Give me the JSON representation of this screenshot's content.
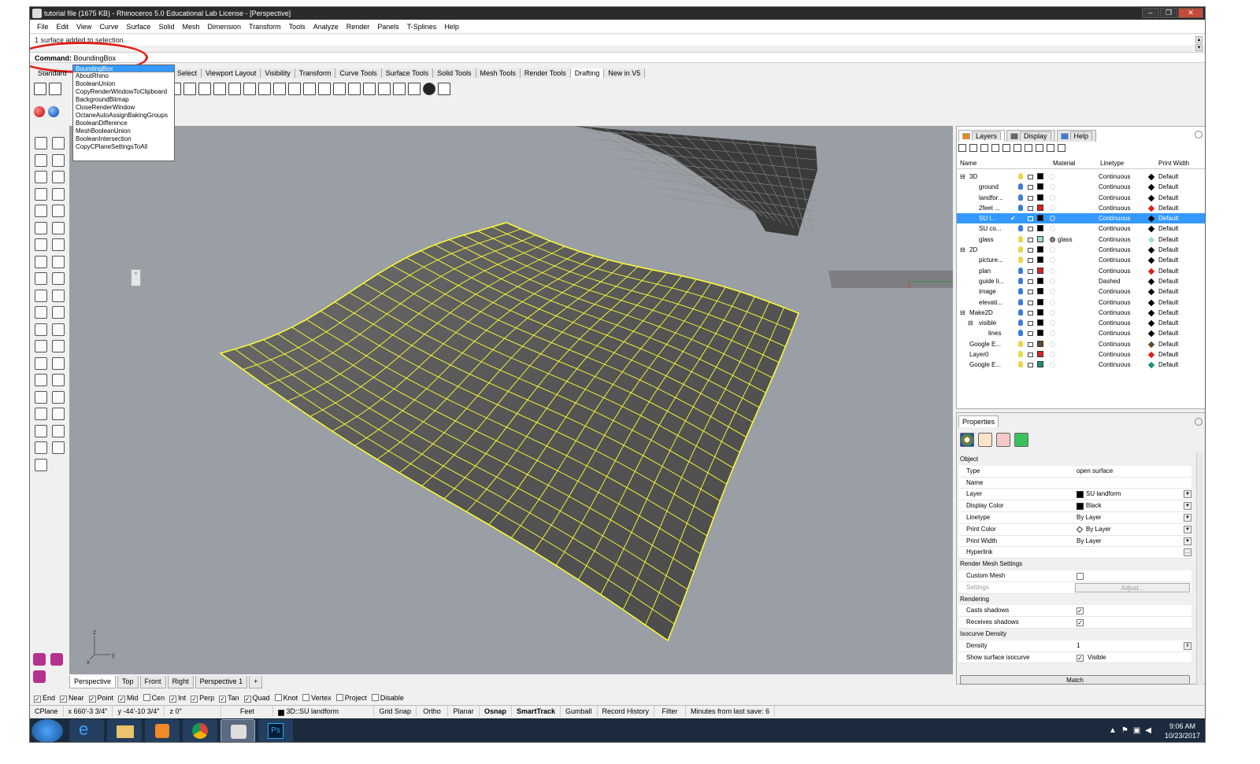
{
  "window": {
    "title": "tutorial file (1675 KB) - Rhinoceros 5.0 Educational Lab License - [Perspective]",
    "buttons": [
      "–",
      "❐",
      "✕"
    ]
  },
  "menu": [
    "File",
    "Edit",
    "View",
    "Curve",
    "Surface",
    "Solid",
    "Mesh",
    "Dimension",
    "Transform",
    "Tools",
    "Analyze",
    "Render",
    "Panels",
    "T-Splines",
    "Help"
  ],
  "command": {
    "history_line": "1 surface added to selection.",
    "prompt_label": "Command:",
    "current_input": "BoundingBox"
  },
  "autocomplete": {
    "items": [
      "BoundingBox",
      "AboutRhino",
      "BooleanUnion",
      "CopyRenderWindowToClipboard",
      "BackgroundBitmap",
      "CloseRenderWindow",
      "OctaneAutoAssignBakingGroups",
      "BooleanDifference",
      "MeshBooleanUnion",
      "BooleanIntersection",
      "CopyCPlaneSettingsToAll"
    ]
  },
  "toolbar_tabs": {
    "standard": "Standard",
    "tabs": [
      "Select",
      "Viewport Layout",
      "Visibility",
      "Transform",
      "Curve Tools",
      "Surface Tools",
      "Solid Tools",
      "Mesh Tools",
      "Render Tools",
      "Drafting",
      "New in V5"
    ]
  },
  "viewport": {
    "axis_z": "z",
    "axis_x": "x",
    "axis_y": "y",
    "tabs": [
      "Perspective",
      "Top",
      "Front",
      "Right",
      "Perspective 1",
      "+"
    ]
  },
  "osnap": [
    {
      "label": "End",
      "checked": true
    },
    {
      "label": "Near",
      "checked": true
    },
    {
      "label": "Point",
      "checked": true
    },
    {
      "label": "Mid",
      "checked": true
    },
    {
      "label": "Cen",
      "checked": false
    },
    {
      "label": "Int",
      "checked": true
    },
    {
      "label": "Perp",
      "checked": true
    },
    {
      "label": "Tan",
      "checked": true
    },
    {
      "label": "Quad",
      "checked": true
    },
    {
      "label": "Knot",
      "checked": false
    },
    {
      "label": "Vertex",
      "checked": false
    },
    {
      "label": "Project",
      "checked": false
    },
    {
      "label": "Disable",
      "checked": false
    }
  ],
  "status": {
    "cplane": "CPlane",
    "x": "x 660'-3 3/4\"",
    "y": "y -44'-10 3/4\"",
    "z": "z 0\"",
    "units": "Feet",
    "layer": "3D::SU landform",
    "toggles": [
      "Grid Snap",
      "Ortho",
      "Planar",
      "Osnap",
      "SmartTrack",
      "Gumball",
      "Record History",
      "Filter"
    ],
    "bold_toggles": [
      "Osnap",
      "SmartTrack"
    ],
    "save_info": "Minutes from last save: 6"
  },
  "taskbar": {
    "time": "9:06 AM",
    "date": "10/23/2017"
  },
  "layers_panel": {
    "tabs": [
      "Layers",
      "Display",
      "Help"
    ],
    "columns": {
      "name": "Name",
      "material": "Material",
      "linetype": "Linetype",
      "print_width": "Print Width"
    },
    "rows": [
      {
        "expander": "⊟",
        "indent": 0,
        "name": "3D",
        "color": "#000000",
        "linetype": "Continuous",
        "pw": "Default",
        "pwcolor": "#000000",
        "bulb": "#e8d84a",
        "selected": false
      },
      {
        "expander": "",
        "indent": 1,
        "name": "ground",
        "color": "#000000",
        "linetype": "Continuous",
        "pw": "Default",
        "pwcolor": "#000000",
        "bulb": "#3c7bd6",
        "selected": false
      },
      {
        "expander": "",
        "indent": 1,
        "name": "landfor...",
        "color": "#000000",
        "linetype": "Continuous",
        "pw": "Default",
        "pwcolor": "#000000",
        "bulb": "#3c7bd6",
        "selected": false
      },
      {
        "expander": "",
        "indent": 1,
        "name": "2feet ...",
        "color": "#e0201a",
        "linetype": "Continuous",
        "pw": "Default",
        "pwcolor": "#e0201a",
        "bulb": "#3c7bd6",
        "selected": false
      },
      {
        "expander": "",
        "indent": 1,
        "name": "SU l...",
        "color": "#000000",
        "linetype": "Continuous",
        "pw": "Default",
        "pwcolor": "#000000",
        "bulb": "",
        "selected": true,
        "check": "✔"
      },
      {
        "expander": "",
        "indent": 1,
        "name": "SU co...",
        "color": "#000000",
        "linetype": "Continuous",
        "pw": "Default",
        "pwcolor": "#000000",
        "bulb": "#3c7bd6",
        "selected": false
      },
      {
        "expander": "",
        "indent": 1,
        "name": "glass",
        "color": "#9ee0c8",
        "linetype": "Continuous",
        "pw": "Default",
        "pwcolor": "#9ee0c8",
        "bulb": "#e8d84a",
        "selected": false,
        "material": "glass"
      },
      {
        "expander": "⊟",
        "indent": 0,
        "name": "2D",
        "color": "#000000",
        "linetype": "Continuous",
        "pw": "Default",
        "pwcolor": "#000000",
        "bulb": "#e8d84a",
        "selected": false
      },
      {
        "expander": "",
        "indent": 1,
        "name": "picture...",
        "color": "#000000",
        "linetype": "Continuous",
        "pw": "Default",
        "pwcolor": "#000000",
        "bulb": "#e8d84a",
        "selected": false
      },
      {
        "expander": "",
        "indent": 1,
        "name": "plan",
        "color": "#e0201a",
        "linetype": "Continuous",
        "pw": "Default",
        "pwcolor": "#e0201a",
        "bulb": "#3c7bd6",
        "selected": false
      },
      {
        "expander": "",
        "indent": 1,
        "name": "guide li...",
        "color": "#000000",
        "linetype": "Dashed",
        "pw": "Default",
        "pwcolor": "#000000",
        "bulb": "#3c7bd6",
        "selected": false
      },
      {
        "expander": "",
        "indent": 1,
        "name": "image",
        "color": "#000000",
        "linetype": "Continuous",
        "pw": "Default",
        "pwcolor": "#000000",
        "bulb": "#3c7bd6",
        "selected": false
      },
      {
        "expander": "",
        "indent": 1,
        "name": "elevati...",
        "color": "#000000",
        "linetype": "Continuous",
        "pw": "Default",
        "pwcolor": "#000000",
        "bulb": "#3c7bd6",
        "selected": false
      },
      {
        "expander": "⊟",
        "indent": 0,
        "name": "Make2D",
        "color": "#000000",
        "linetype": "Continuous",
        "pw": "Default",
        "pwcolor": "#000000",
        "bulb": "#3c7bd6",
        "selected": false
      },
      {
        "expander": "⊟",
        "indent": 1,
        "name": "visible",
        "color": "#000000",
        "linetype": "Continuous",
        "pw": "Default",
        "pwcolor": "#000000",
        "bulb": "#3c7bd6",
        "selected": false
      },
      {
        "expander": "",
        "indent": 2,
        "name": "lines",
        "color": "#000000",
        "linetype": "Continuous",
        "pw": "Default",
        "pwcolor": "#000000",
        "bulb": "#3c7bd6",
        "selected": false
      },
      {
        "expander": "",
        "indent": 0,
        "name": "Google E...",
        "color": "#6b4a2a",
        "linetype": "Continuous",
        "pw": "Default",
        "pwcolor": "#6b4a2a",
        "bulb": "#e8d84a",
        "selected": false
      },
      {
        "expander": "",
        "indent": 0,
        "name": "Layer0",
        "color": "#e0201a",
        "linetype": "Continuous",
        "pw": "Default",
        "pwcolor": "#e0201a",
        "bulb": "#e8d84a",
        "selected": false
      },
      {
        "expander": "",
        "indent": 0,
        "name": "Google E...",
        "color": "#1e8f7a",
        "linetype": "Continuous",
        "pw": "Default",
        "pwcolor": "#1e8f7a",
        "bulb": "#e8d84a",
        "selected": false
      }
    ]
  },
  "properties_panel": {
    "tab": "Properties",
    "rows": [
      {
        "section": true,
        "label": "Object"
      },
      {
        "label": "Type",
        "value": "open surface"
      },
      {
        "label": "Name",
        "value": ""
      },
      {
        "label": "Layer",
        "value": "SU landform",
        "swatch": "#000000",
        "dropdown": true
      },
      {
        "label": "Display Color",
        "value": "Black",
        "swatch": "#000000",
        "dropdown": true
      },
      {
        "label": "Linetype",
        "value": "By Layer",
        "dropdown": true
      },
      {
        "label": "Print Color",
        "value": "By Layer",
        "diamond": true,
        "dropdown": true
      },
      {
        "label": "Print Width",
        "value": "By Layer",
        "dropdown": true
      },
      {
        "label": "Hyperlink",
        "value": "",
        "ellipsis": true
      },
      {
        "section": true,
        "label": "Render Mesh Settings"
      },
      {
        "label": "Custom Mesh",
        "checkbox": true,
        "checked": false
      },
      {
        "label": "Settings",
        "value": "Adjust...",
        "disabled": true,
        "button": true
      },
      {
        "section": true,
        "label": "Rendering"
      },
      {
        "label": "Casts shadows",
        "checkbox": true,
        "checked": true
      },
      {
        "label": "Receives shadows",
        "checkbox": true,
        "checked": true
      },
      {
        "section": true,
        "label": "Isocurve Density"
      },
      {
        "label": "Density",
        "value": "1",
        "spinner": true
      },
      {
        "label": "Show surface isocurve",
        "checkbox": true,
        "checked": true,
        "value": "Visible"
      }
    ],
    "match_button": "Match"
  },
  "colors": {
    "viewport_bg": "#9a9fa5",
    "surface_wire": "#ffff33",
    "selection": "#3399ff",
    "annotation_red": "#e0201a"
  }
}
